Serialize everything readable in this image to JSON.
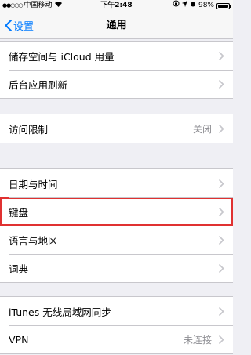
{
  "status_bar": {
    "signal_dots": "●●○○○",
    "carrier": "中国移动",
    "wifi_icon": "wifi-icon",
    "time": "下午2:48",
    "battery_percent": "98%",
    "battery_level": 0.98
  },
  "nav": {
    "back_label": "设置",
    "title": "通用"
  },
  "groups": [
    [
      {
        "label": "储存空间与 iCloud 用量",
        "value": ""
      },
      {
        "label": "后台应用刷新",
        "value": ""
      }
    ],
    [
      {
        "label": "访问限制",
        "value": "关闭"
      }
    ],
    [
      {
        "label": "日期与时间",
        "value": ""
      },
      {
        "label": "键盘",
        "value": ""
      },
      {
        "label": "语言与地区",
        "value": ""
      },
      {
        "label": "词典",
        "value": ""
      }
    ],
    [
      {
        "label": "iTunes 无线局域网同步",
        "value": ""
      },
      {
        "label": "VPN",
        "value": "未连接"
      }
    ]
  ],
  "colors": {
    "accent": "#007aff",
    "highlight_border": "#e03131",
    "background": "#efeff4"
  }
}
